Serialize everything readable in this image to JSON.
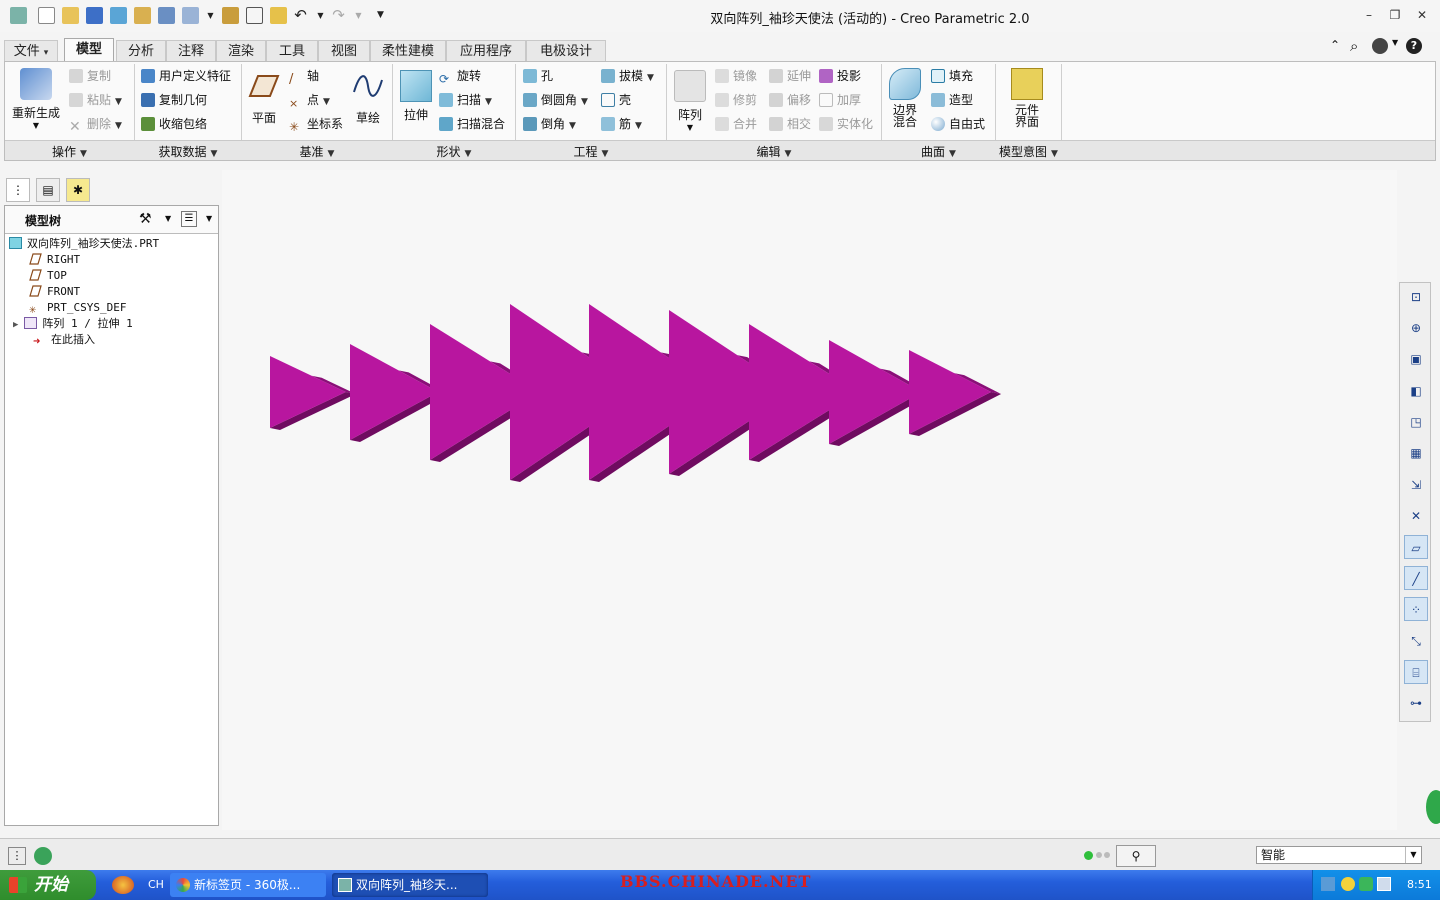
{
  "window": {
    "title": "双向阵列_袖珍天使法 (活动的) - Creo Parametric 2.0",
    "minimize": "–",
    "restore": "❐",
    "close": "✕"
  },
  "ribbon_tabs": [
    "文件",
    "模型",
    "分析",
    "注释",
    "渲染",
    "工具",
    "视图",
    "柔性建模",
    "应用程序",
    "电极设计"
  ],
  "ribbon": {
    "operations": {
      "regenerate": "重新生成",
      "copy": "复制",
      "paste": "粘贴",
      "delete": "删除"
    },
    "get_data": {
      "udf": "用户定义特征",
      "copy_geom": "复制几何",
      "shrinkwrap": "收缩包络"
    },
    "datum": {
      "plane": "平面",
      "axis": "轴",
      "point": "点",
      "csys": "坐标系",
      "sketch": "草绘"
    },
    "shapes": {
      "extrude": "拉伸",
      "revolve": "旋转",
      "sweep": "扫描",
      "swept_blend": "扫描混合"
    },
    "engineering": {
      "hole": "孔",
      "round": "倒圆角",
      "chamfer": "倒角",
      "draft": "拔模",
      "shell": "壳",
      "rib": "筋"
    },
    "editing": {
      "pattern": "阵列",
      "mirror": "镜像",
      "trim": "修剪",
      "merge": "合并",
      "extend": "延伸",
      "offset": "偏移",
      "intersect": "相交",
      "project": "投影",
      "thicken": "加厚",
      "solidify": "实体化"
    },
    "surfaces": {
      "boundary_blend_1": "边界",
      "boundary_blend_2": "混合",
      "fill": "填充",
      "style": "造型",
      "freestyle": "自由式"
    },
    "intent": {
      "component_interface_1": "元件",
      "component_interface_2": "界面"
    },
    "group_labels": [
      "操作",
      "获取数据",
      "基准",
      "形状",
      "工程",
      "编辑",
      "曲面",
      "模型意图"
    ]
  },
  "model_tree": {
    "title": "模型树",
    "items": [
      {
        "label": "双向阵列_袖珍天使法.PRT",
        "icon": "part-icon"
      },
      {
        "label": "RIGHT",
        "icon": "datum-plane-icon"
      },
      {
        "label": "TOP",
        "icon": "datum-plane-icon"
      },
      {
        "label": "FRONT",
        "icon": "datum-plane-icon"
      },
      {
        "label": "PRT_CSYS_DEF",
        "icon": "csys-icon"
      },
      {
        "label": "阵列 1 / 拉伸 1",
        "icon": "pattern-icon"
      },
      {
        "label": "在此插入",
        "icon": "insert-here-arrow-icon"
      }
    ]
  },
  "model_color": "#b8169f",
  "status": {
    "filter_value": "智能"
  },
  "taskbar": {
    "start": "开始",
    "lang": "CH",
    "tasks": [
      "新标签页 - 360极...",
      "双向阵列_袖珍天..."
    ],
    "watermark": "BBS.CHINADE.NET",
    "clock": "8:51"
  }
}
